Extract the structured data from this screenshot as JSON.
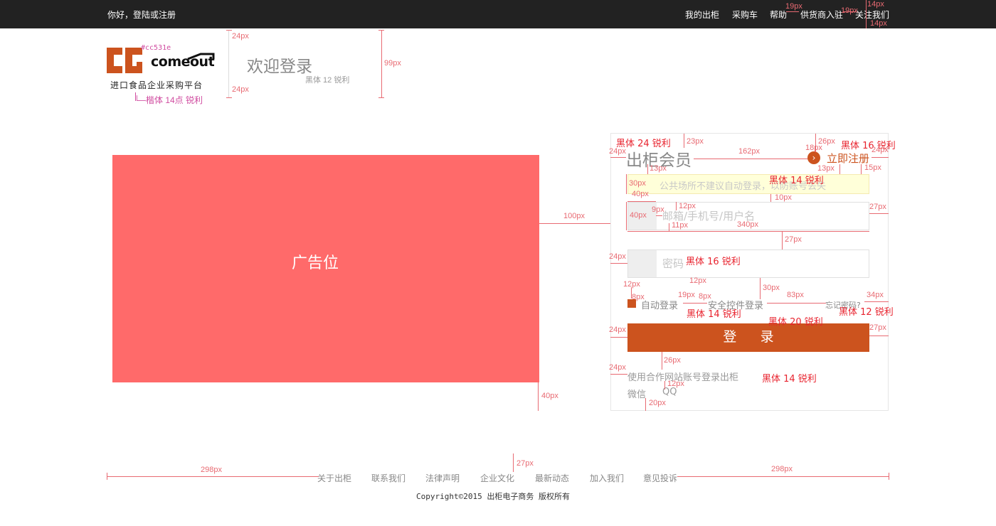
{
  "topbar": {
    "greeting": "你好，登陆或注册",
    "nav": [
      "我的出柜",
      "采购车",
      "帮助",
      "供货商入驻",
      "关注我们"
    ]
  },
  "brand": {
    "logo_color": "#cc531e",
    "logo_word": "comeout",
    "tagline": "进口食品企业采购平台",
    "welcome": "欢迎登录"
  },
  "ad": {
    "label": "广告位",
    "color": "#ff6a6a"
  },
  "login": {
    "title": "出柜会员",
    "register_icon": "chevron-right-circle-icon",
    "register": "立即注册",
    "notice": "公共场所不建议自动登录，以防账号丢失",
    "username_placeholder": "邮箱/手机号/用户名",
    "password_placeholder": "密码",
    "auto_login": "自动登录",
    "secure_login": "安全控件登录",
    "forgot": "忘记密码?",
    "submit": "登 录",
    "partner_title": "使用合作网站账号登录出柜",
    "wechat": "微信",
    "qq": "QQ",
    "accent": "#cc531e"
  },
  "footer": {
    "links": [
      "关于出柜",
      "联系我们",
      "法律声明",
      "企业文化",
      "最新动态",
      "加入我们",
      "意见投诉"
    ],
    "copyright": "Copyright©2015   出柜电子商务 版权所有"
  },
  "annotations": {
    "color_hex": "#cc531e",
    "font_kaiti": "└─楷体 14点 锐利",
    "font_hei12": "黑体 12 锐利",
    "font_hei24": "黑体 24 锐利",
    "font_hei16a": "黑体 16 锐利",
    "font_hei14a": "黑体 14 锐利",
    "font_hei16b": "黑体 16 锐利",
    "font_hei14b": "黑体 14 锐利",
    "font_hei20": "黑体 20 锐利",
    "font_hei12b": "黑体 12 锐利",
    "font_hei14c": "黑体 14 锐利",
    "d24a": "24px",
    "d24b": "24px",
    "d99": "99px",
    "d23": "23px",
    "d26": "26px",
    "d18": "18px",
    "d24c": "24px",
    "d24d": "24px",
    "d162": "162px",
    "d13a": "13px",
    "d13b": "13px",
    "d15": "15px",
    "d30a": "30px",
    "d40a": "40px",
    "d10": "10px",
    "d12a": "12px",
    "d9": "9px",
    "d40b": "40px",
    "d11": "11px",
    "d340": "340px",
    "d27a": "27px",
    "d27b": "27px",
    "d100": "100px",
    "d24e": "24px",
    "d12b": "12px",
    "d12c": "12px",
    "d8a": "8px",
    "d19a": "19px",
    "d8b": "8px",
    "d30b": "30px",
    "d83": "83px",
    "d34": "34px",
    "d24f": "24px",
    "d27c": "27px",
    "d26b": "26px",
    "d24g": "24px",
    "d12d": "12px",
    "d20": "20px",
    "d40c": "40px",
    "d27d": "27px",
    "d298a": "298px",
    "d298b": "298px",
    "d19b": "19px",
    "d19c": "19px",
    "d14a": "14px",
    "d14b": "14px"
  }
}
